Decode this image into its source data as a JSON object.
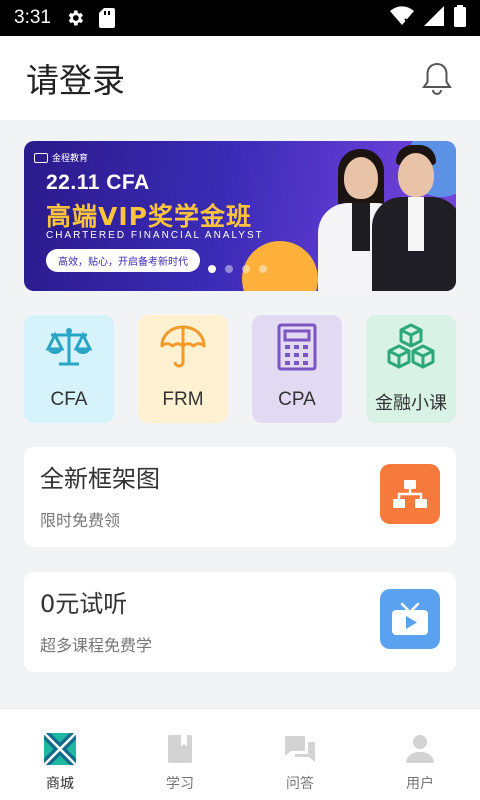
{
  "status_bar": {
    "time": "3:31",
    "icons": [
      "gear-icon",
      "sd-card-icon",
      "wifi-icon",
      "signal-icon",
      "battery-icon"
    ]
  },
  "header": {
    "title": "请登录",
    "icon": "bell-icon"
  },
  "banner": {
    "logo_text": "金程教育",
    "headline": "22.11 CFA",
    "vip_text": "高端VIP奖学金班",
    "subtitle": "CHARTERED FINANCIAL ANALYST",
    "pill_text": "高效，贴心，开启备考新时代",
    "slide_count": 4,
    "active_slide": 1
  },
  "categories": [
    {
      "label": "CFA",
      "icon": "scale-icon",
      "color": "#2aa4c5"
    },
    {
      "label": "FRM",
      "icon": "umbrella-icon",
      "color": "#f39a2b"
    },
    {
      "label": "CPA",
      "icon": "calculator-icon",
      "color": "#7b55c2"
    },
    {
      "label": "金融小课",
      "icon": "cubes-icon",
      "color": "#2ea87a"
    }
  ],
  "cards": [
    {
      "title": "全新框架图",
      "subtitle": "限时免费领",
      "icon": "sitemap-icon",
      "color": "#f77a3d"
    },
    {
      "title": "0元试听",
      "subtitle": "超多课程免费学",
      "icon": "tv-play-icon",
      "color": "#5aa2f0"
    }
  ],
  "bottom_nav": [
    {
      "label": "商城",
      "icon": "store-icon",
      "active": true
    },
    {
      "label": "学习",
      "icon": "book-icon",
      "active": false
    },
    {
      "label": "问答",
      "icon": "chat-icon",
      "active": false
    },
    {
      "label": "用户",
      "icon": "user-icon",
      "active": false
    }
  ]
}
